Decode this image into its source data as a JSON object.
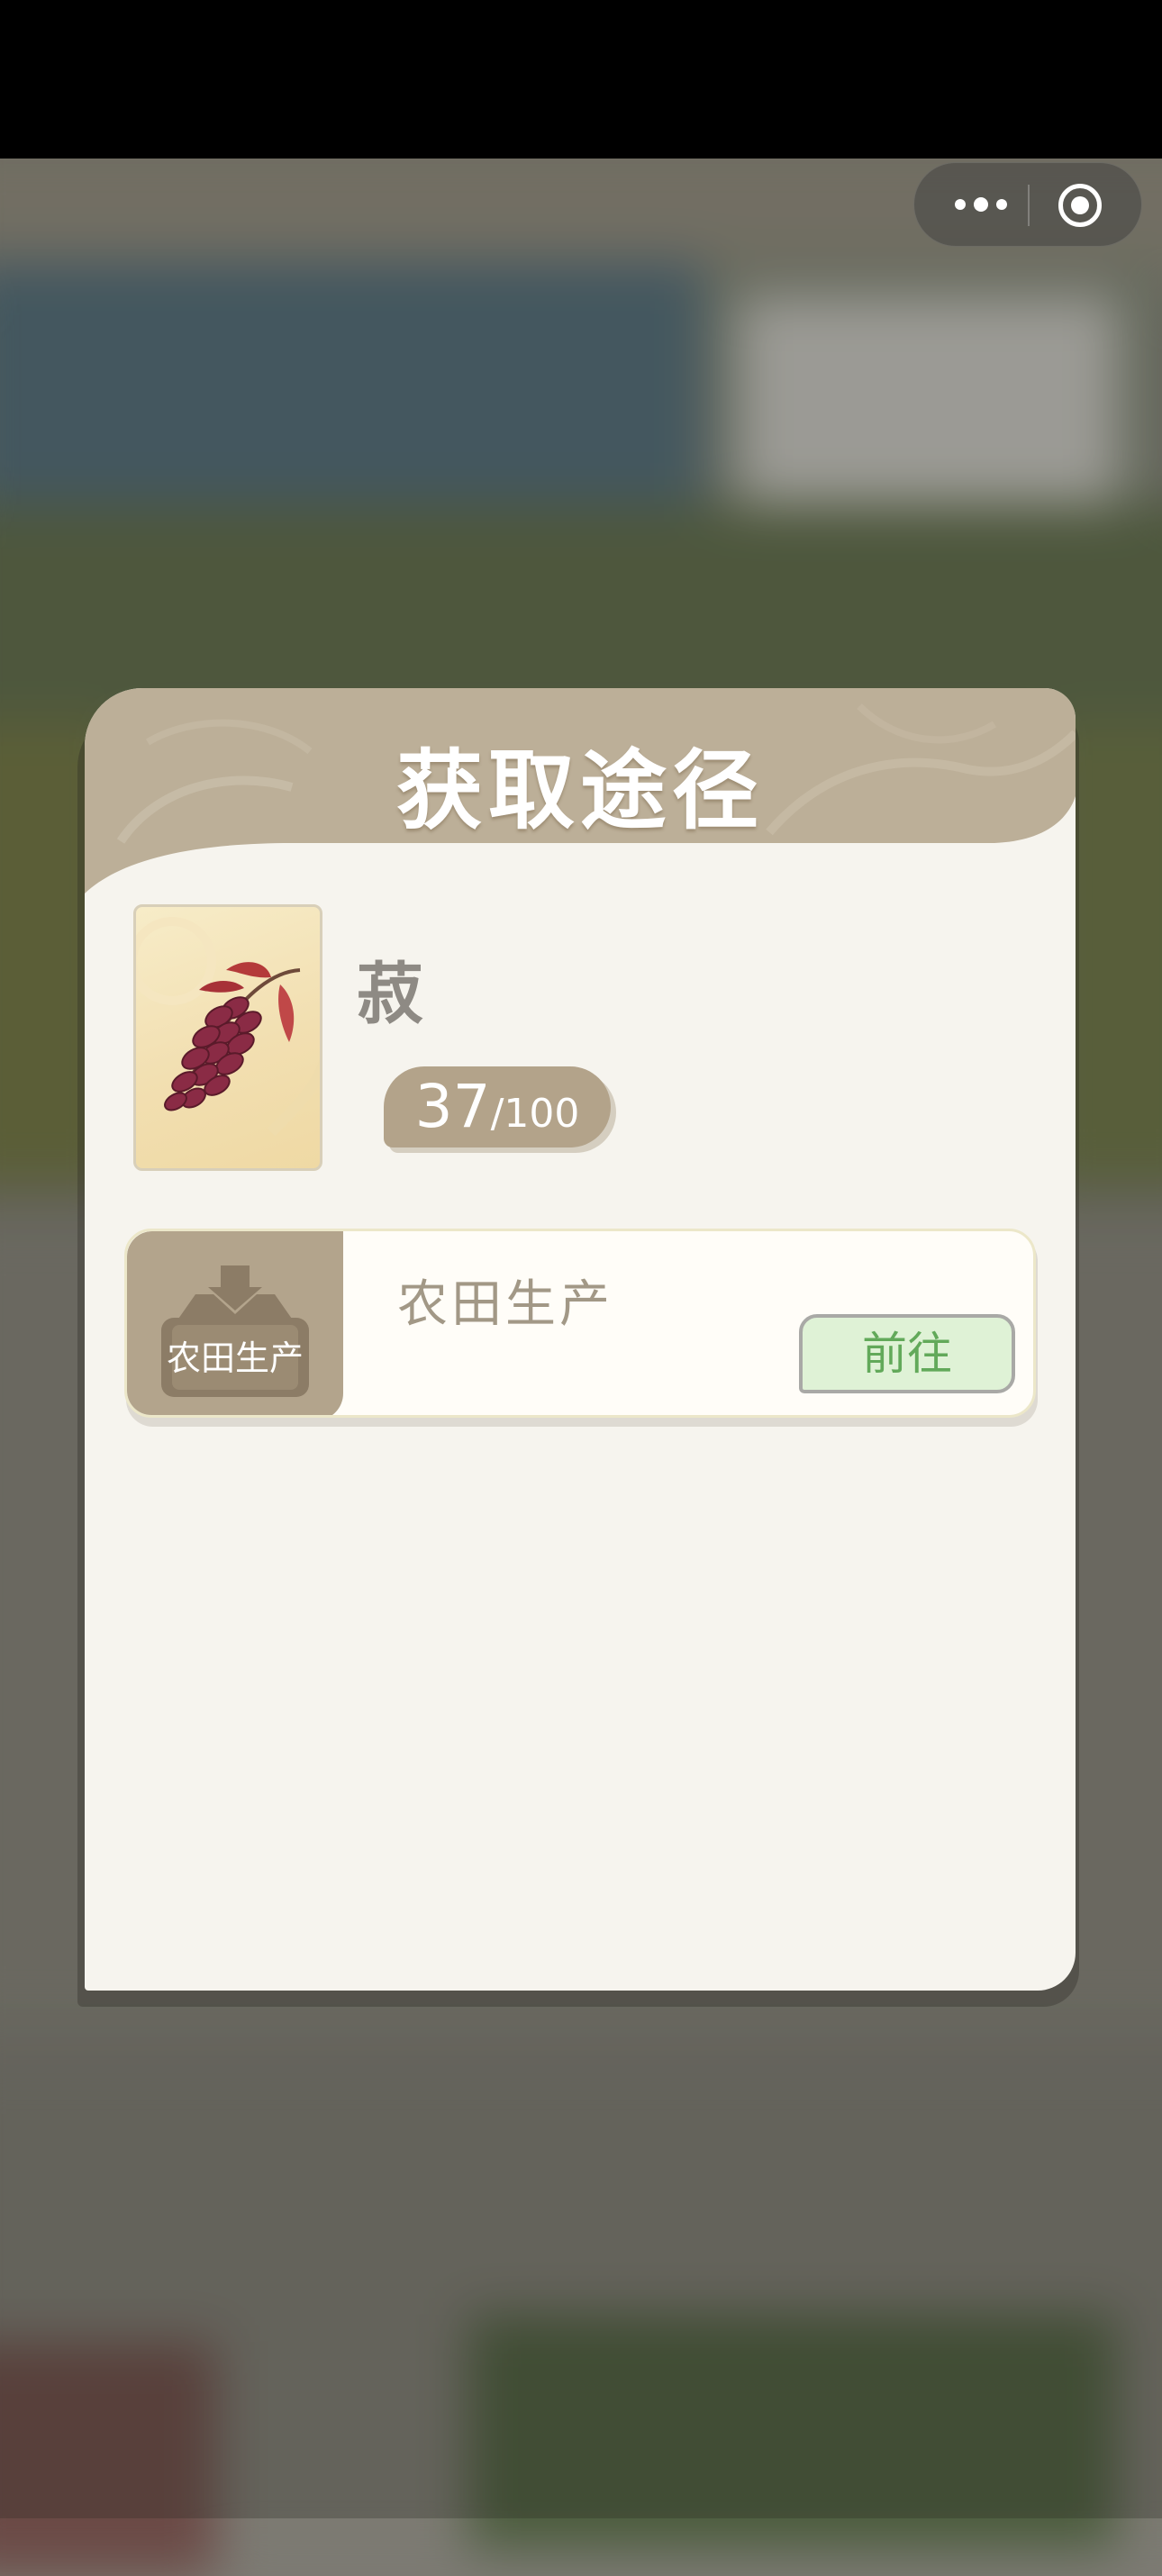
{
  "dialog": {
    "title": "获取途径",
    "item": {
      "name": "菽",
      "count_current": "37",
      "count_separator": "/",
      "count_max": "100"
    },
    "sources": [
      {
        "icon_label": "农田生产",
        "title": "农田生产",
        "action_label": "前往"
      }
    ]
  },
  "icons": {
    "more": "more-dots-icon",
    "close": "close-target-icon",
    "item": "red-grain-cluster-icon",
    "source": "inbox-tray-icon"
  },
  "colors": {
    "header": "#bcaf98",
    "card": "#f6f4ee",
    "pill": "#b3a38a",
    "button_bg": "#dff2d6",
    "button_text": "#62a95a"
  }
}
